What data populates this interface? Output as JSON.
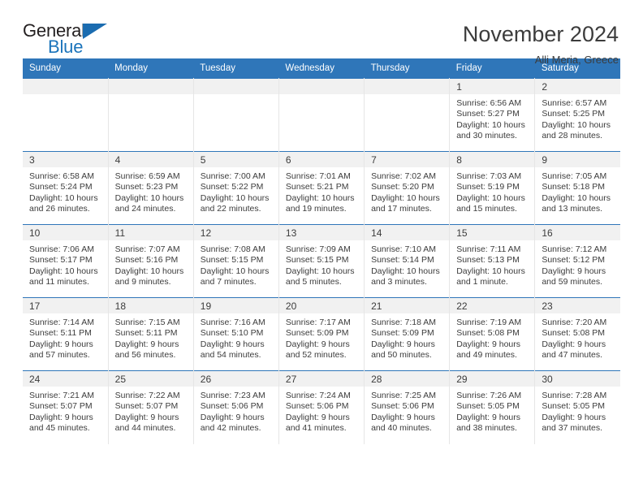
{
  "brand": {
    "name_part1": "General",
    "name_part2": "Blue",
    "triangle_icon": "triangle-icon",
    "accent_color": "#1b6cb0"
  },
  "header": {
    "month_title": "November 2024",
    "location": "Alli Meria, Greece"
  },
  "theme": {
    "header_blue": "#2f76b9",
    "daynum_bg": "#f1f1f1",
    "text": "#3c3c3c",
    "cell_divider": "#e6e6e6"
  },
  "calendar": {
    "weekday_headers": [
      "Sunday",
      "Monday",
      "Tuesday",
      "Wednesday",
      "Thursday",
      "Friday",
      "Saturday"
    ],
    "labels": {
      "sunrise": "Sunrise:",
      "sunset": "Sunset:",
      "daylight": "Daylight:"
    },
    "weeks": [
      [
        {
          "day": "",
          "sunrise": "",
          "sunset": "",
          "daylight_line1": "",
          "daylight_line2": "",
          "empty": true
        },
        {
          "day": "",
          "sunrise": "",
          "sunset": "",
          "daylight_line1": "",
          "daylight_line2": "",
          "empty": true
        },
        {
          "day": "",
          "sunrise": "",
          "sunset": "",
          "daylight_line1": "",
          "daylight_line2": "",
          "empty": true
        },
        {
          "day": "",
          "sunrise": "",
          "sunset": "",
          "daylight_line1": "",
          "daylight_line2": "",
          "empty": true
        },
        {
          "day": "",
          "sunrise": "",
          "sunset": "",
          "daylight_line1": "",
          "daylight_line2": "",
          "empty": true
        },
        {
          "day": "1",
          "sunrise": "Sunrise: 6:56 AM",
          "sunset": "Sunset: 5:27 PM",
          "daylight_line1": "Daylight: 10 hours",
          "daylight_line2": "and 30 minutes."
        },
        {
          "day": "2",
          "sunrise": "Sunrise: 6:57 AM",
          "sunset": "Sunset: 5:25 PM",
          "daylight_line1": "Daylight: 10 hours",
          "daylight_line2": "and 28 minutes."
        }
      ],
      [
        {
          "day": "3",
          "sunrise": "Sunrise: 6:58 AM",
          "sunset": "Sunset: 5:24 PM",
          "daylight_line1": "Daylight: 10 hours",
          "daylight_line2": "and 26 minutes."
        },
        {
          "day": "4",
          "sunrise": "Sunrise: 6:59 AM",
          "sunset": "Sunset: 5:23 PM",
          "daylight_line1": "Daylight: 10 hours",
          "daylight_line2": "and 24 minutes."
        },
        {
          "day": "5",
          "sunrise": "Sunrise: 7:00 AM",
          "sunset": "Sunset: 5:22 PM",
          "daylight_line1": "Daylight: 10 hours",
          "daylight_line2": "and 22 minutes."
        },
        {
          "day": "6",
          "sunrise": "Sunrise: 7:01 AM",
          "sunset": "Sunset: 5:21 PM",
          "daylight_line1": "Daylight: 10 hours",
          "daylight_line2": "and 19 minutes."
        },
        {
          "day": "7",
          "sunrise": "Sunrise: 7:02 AM",
          "sunset": "Sunset: 5:20 PM",
          "daylight_line1": "Daylight: 10 hours",
          "daylight_line2": "and 17 minutes."
        },
        {
          "day": "8",
          "sunrise": "Sunrise: 7:03 AM",
          "sunset": "Sunset: 5:19 PM",
          "daylight_line1": "Daylight: 10 hours",
          "daylight_line2": "and 15 minutes."
        },
        {
          "day": "9",
          "sunrise": "Sunrise: 7:05 AM",
          "sunset": "Sunset: 5:18 PM",
          "daylight_line1": "Daylight: 10 hours",
          "daylight_line2": "and 13 minutes."
        }
      ],
      [
        {
          "day": "10",
          "sunrise": "Sunrise: 7:06 AM",
          "sunset": "Sunset: 5:17 PM",
          "daylight_line1": "Daylight: 10 hours",
          "daylight_line2": "and 11 minutes."
        },
        {
          "day": "11",
          "sunrise": "Sunrise: 7:07 AM",
          "sunset": "Sunset: 5:16 PM",
          "daylight_line1": "Daylight: 10 hours",
          "daylight_line2": "and 9 minutes."
        },
        {
          "day": "12",
          "sunrise": "Sunrise: 7:08 AM",
          "sunset": "Sunset: 5:15 PM",
          "daylight_line1": "Daylight: 10 hours",
          "daylight_line2": "and 7 minutes."
        },
        {
          "day": "13",
          "sunrise": "Sunrise: 7:09 AM",
          "sunset": "Sunset: 5:15 PM",
          "daylight_line1": "Daylight: 10 hours",
          "daylight_line2": "and 5 minutes."
        },
        {
          "day": "14",
          "sunrise": "Sunrise: 7:10 AM",
          "sunset": "Sunset: 5:14 PM",
          "daylight_line1": "Daylight: 10 hours",
          "daylight_line2": "and 3 minutes."
        },
        {
          "day": "15",
          "sunrise": "Sunrise: 7:11 AM",
          "sunset": "Sunset: 5:13 PM",
          "daylight_line1": "Daylight: 10 hours",
          "daylight_line2": "and 1 minute."
        },
        {
          "day": "16",
          "sunrise": "Sunrise: 7:12 AM",
          "sunset": "Sunset: 5:12 PM",
          "daylight_line1": "Daylight: 9 hours",
          "daylight_line2": "and 59 minutes."
        }
      ],
      [
        {
          "day": "17",
          "sunrise": "Sunrise: 7:14 AM",
          "sunset": "Sunset: 5:11 PM",
          "daylight_line1": "Daylight: 9 hours",
          "daylight_line2": "and 57 minutes."
        },
        {
          "day": "18",
          "sunrise": "Sunrise: 7:15 AM",
          "sunset": "Sunset: 5:11 PM",
          "daylight_line1": "Daylight: 9 hours",
          "daylight_line2": "and 56 minutes."
        },
        {
          "day": "19",
          "sunrise": "Sunrise: 7:16 AM",
          "sunset": "Sunset: 5:10 PM",
          "daylight_line1": "Daylight: 9 hours",
          "daylight_line2": "and 54 minutes."
        },
        {
          "day": "20",
          "sunrise": "Sunrise: 7:17 AM",
          "sunset": "Sunset: 5:09 PM",
          "daylight_line1": "Daylight: 9 hours",
          "daylight_line2": "and 52 minutes."
        },
        {
          "day": "21",
          "sunrise": "Sunrise: 7:18 AM",
          "sunset": "Sunset: 5:09 PM",
          "daylight_line1": "Daylight: 9 hours",
          "daylight_line2": "and 50 minutes."
        },
        {
          "day": "22",
          "sunrise": "Sunrise: 7:19 AM",
          "sunset": "Sunset: 5:08 PM",
          "daylight_line1": "Daylight: 9 hours",
          "daylight_line2": "and 49 minutes."
        },
        {
          "day": "23",
          "sunrise": "Sunrise: 7:20 AM",
          "sunset": "Sunset: 5:08 PM",
          "daylight_line1": "Daylight: 9 hours",
          "daylight_line2": "and 47 minutes."
        }
      ],
      [
        {
          "day": "24",
          "sunrise": "Sunrise: 7:21 AM",
          "sunset": "Sunset: 5:07 PM",
          "daylight_line1": "Daylight: 9 hours",
          "daylight_line2": "and 45 minutes."
        },
        {
          "day": "25",
          "sunrise": "Sunrise: 7:22 AM",
          "sunset": "Sunset: 5:07 PM",
          "daylight_line1": "Daylight: 9 hours",
          "daylight_line2": "and 44 minutes."
        },
        {
          "day": "26",
          "sunrise": "Sunrise: 7:23 AM",
          "sunset": "Sunset: 5:06 PM",
          "daylight_line1": "Daylight: 9 hours",
          "daylight_line2": "and 42 minutes."
        },
        {
          "day": "27",
          "sunrise": "Sunrise: 7:24 AM",
          "sunset": "Sunset: 5:06 PM",
          "daylight_line1": "Daylight: 9 hours",
          "daylight_line2": "and 41 minutes."
        },
        {
          "day": "28",
          "sunrise": "Sunrise: 7:25 AM",
          "sunset": "Sunset: 5:06 PM",
          "daylight_line1": "Daylight: 9 hours",
          "daylight_line2": "and 40 minutes."
        },
        {
          "day": "29",
          "sunrise": "Sunrise: 7:26 AM",
          "sunset": "Sunset: 5:05 PM",
          "daylight_line1": "Daylight: 9 hours",
          "daylight_line2": "and 38 minutes."
        },
        {
          "day": "30",
          "sunrise": "Sunrise: 7:28 AM",
          "sunset": "Sunset: 5:05 PM",
          "daylight_line1": "Daylight: 9 hours",
          "daylight_line2": "and 37 minutes."
        }
      ]
    ]
  }
}
